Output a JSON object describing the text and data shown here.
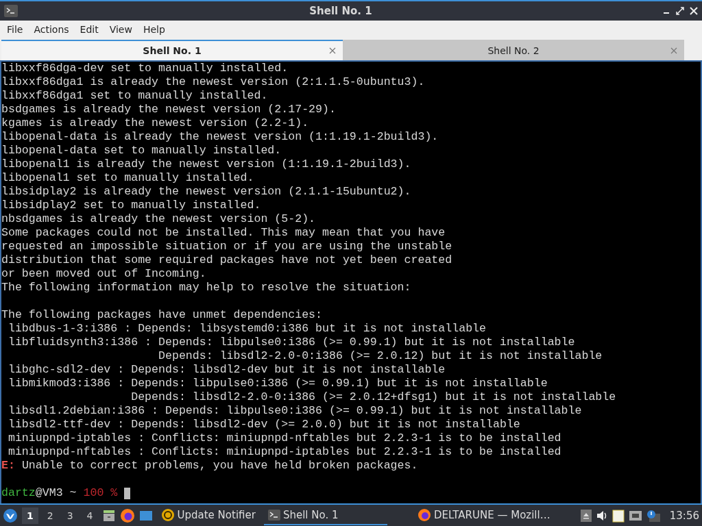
{
  "window": {
    "title": "Shell No. 1"
  },
  "menu": [
    "File",
    "Actions",
    "Edit",
    "View",
    "Help"
  ],
  "tabs": [
    {
      "label": "Shell No. 1",
      "selected": true
    },
    {
      "label": "Shell No. 2",
      "selected": false
    }
  ],
  "terminal": {
    "lines": [
      {
        "kind": "output",
        "text": "libxxf86dga-dev set to manually installed."
      },
      {
        "kind": "output",
        "text": "libxxf86dga1 is already the newest version (2:1.1.5-0ubuntu3)."
      },
      {
        "kind": "output",
        "text": "libxxf86dga1 set to manually installed."
      },
      {
        "kind": "output",
        "text": "bsdgames is already the newest version (2.17-29)."
      },
      {
        "kind": "output",
        "text": "kgames is already the newest version (2.2-1)."
      },
      {
        "kind": "output",
        "text": "libopenal-data is already the newest version (1:1.19.1-2build3)."
      },
      {
        "kind": "output",
        "text": "libopenal-data set to manually installed."
      },
      {
        "kind": "output",
        "text": "libopenal1 is already the newest version (1:1.19.1-2build3)."
      },
      {
        "kind": "output",
        "text": "libopenal1 set to manually installed."
      },
      {
        "kind": "output",
        "text": "libsidplay2 is already the newest version (2.1.1-15ubuntu2)."
      },
      {
        "kind": "output",
        "text": "libsidplay2 set to manually installed."
      },
      {
        "kind": "output",
        "text": "nbsdgames is already the newest version (5-2)."
      },
      {
        "kind": "output",
        "text": "Some packages could not be installed. This may mean that you have"
      },
      {
        "kind": "output",
        "text": "requested an impossible situation or if you are using the unstable"
      },
      {
        "kind": "output",
        "text": "distribution that some required packages have not yet been created"
      },
      {
        "kind": "output",
        "text": "or been moved out of Incoming."
      },
      {
        "kind": "output",
        "text": "The following information may help to resolve the situation:"
      },
      {
        "kind": "blank"
      },
      {
        "kind": "output",
        "text": "The following packages have unmet dependencies:"
      },
      {
        "kind": "output",
        "text": " libdbus-1-3:i386 : Depends: libsystemd0:i386 but it is not installable"
      },
      {
        "kind": "output",
        "text": " libfluidsynth3:i386 : Depends: libpulse0:i386 (>= 0.99.1) but it is not installable"
      },
      {
        "kind": "output",
        "text": "                       Depends: libsdl2-2.0-0:i386 (>= 2.0.12) but it is not installable"
      },
      {
        "kind": "output",
        "text": " libghc-sdl2-dev : Depends: libsdl2-dev but it is not installable"
      },
      {
        "kind": "output",
        "text": " libmikmod3:i386 : Depends: libpulse0:i386 (>= 0.99.1) but it is not installable"
      },
      {
        "kind": "output",
        "text": "                   Depends: libsdl2-2.0-0:i386 (>= 2.0.12+dfsg1) but it is not installable"
      },
      {
        "kind": "output",
        "text": " libsdl1.2debian:i386 : Depends: libpulse0:i386 (>= 0.99.1) but it is not installable"
      },
      {
        "kind": "output",
        "text": " libsdl2-ttf-dev : Depends: libsdl2-dev (>= 2.0.0) but it is not installable"
      },
      {
        "kind": "output",
        "text": " miniupnpd-iptables : Conflicts: miniupnpd-nftables but 2.2.3-1 is to be installed"
      },
      {
        "kind": "output",
        "text": " miniupnpd-nftables : Conflicts: miniupnpd-iptables but 2.2.3-1 is to be installed"
      },
      {
        "kind": "error",
        "prefix": "E:",
        "text": " Unable to correct problems, you have held broken packages."
      },
      {
        "kind": "blank"
      }
    ],
    "prompt": {
      "user": "dartz",
      "host": "@VM3 ~",
      "status": "100 %"
    }
  },
  "taskbar": {
    "workspaces": [
      {
        "label": "1",
        "selected": true
      },
      {
        "label": "2",
        "selected": false
      },
      {
        "label": "3",
        "selected": false
      },
      {
        "label": "4",
        "selected": false
      }
    ],
    "tasks": [
      {
        "kind": "launcher",
        "label": "Update Notifier",
        "selected": false
      },
      {
        "kind": "terminal",
        "label": "Shell No. 1",
        "selected": true
      },
      {
        "kind": "browser",
        "label": "DELTARUNE — Mozill…",
        "selected": false
      }
    ],
    "clock": "13:56"
  }
}
